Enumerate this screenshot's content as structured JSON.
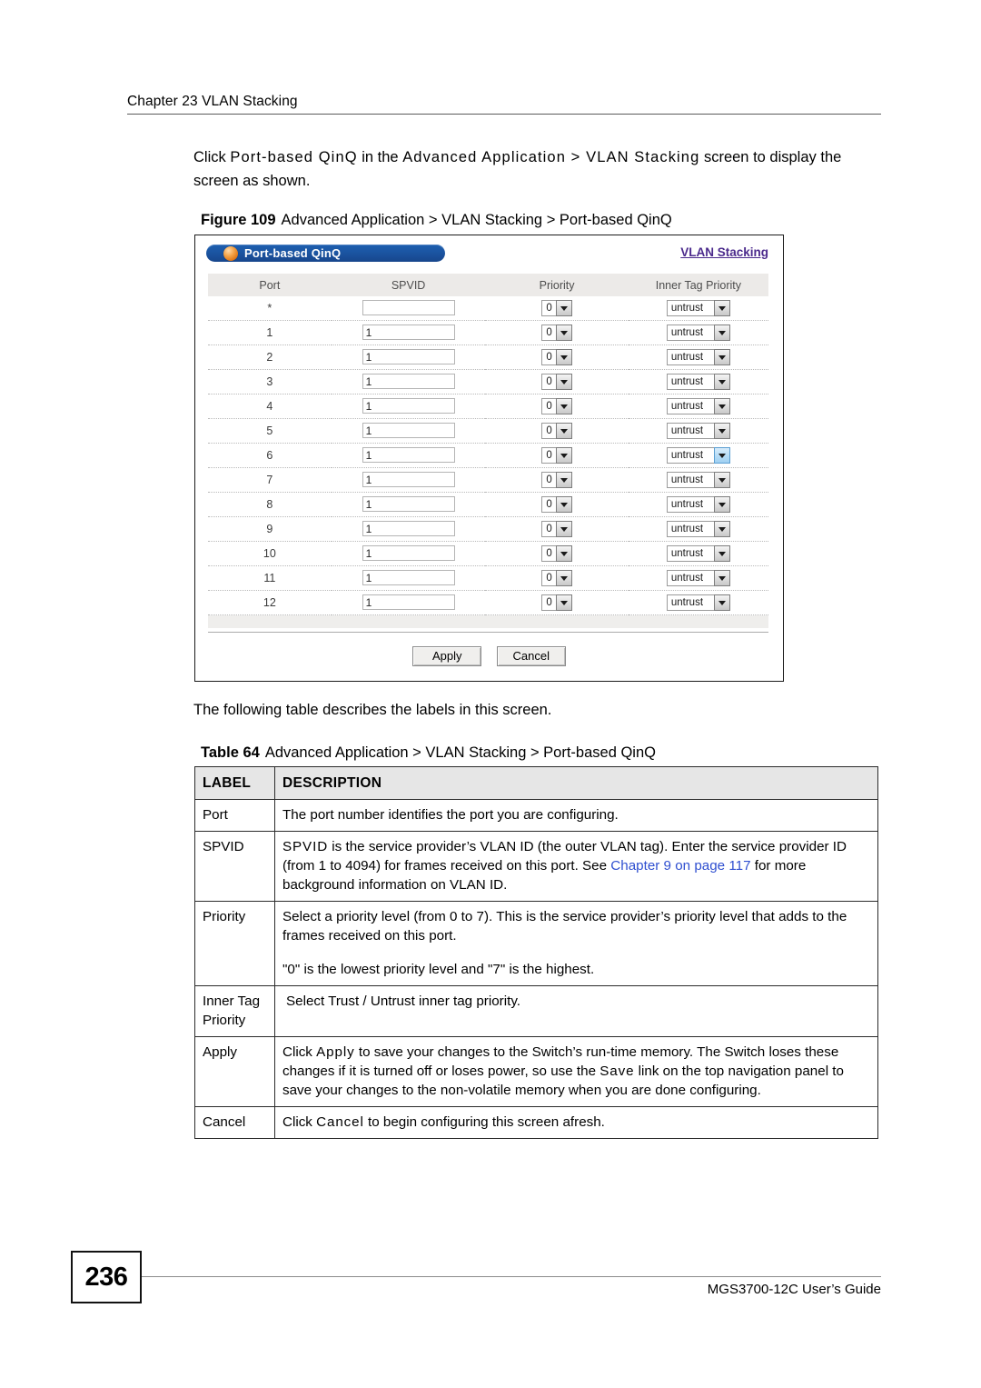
{
  "header": {
    "chapter": "Chapter 23 VLAN Stacking"
  },
  "intro": {
    "line_a": "Click ",
    "term_1": "Port-based QinQ",
    "line_b": " in the ",
    "term_2": "Advanced Application > VLAN Stacking",
    "line_c": " screen to display the screen as shown."
  },
  "figure": {
    "number": "Figure 109",
    "title": "Advanced Application > VLAN Stacking > Port-based QinQ",
    "screen": {
      "titlebar_label": "Port-based QinQ",
      "nav_link": "VLAN Stacking",
      "columns": [
        "Port",
        "SPVID",
        "Priority",
        "Inner Tag Priority"
      ],
      "rows": [
        {
          "port": "*",
          "spvid": "",
          "priority": "0",
          "inner_tag_priority": "untrust",
          "highlight": false
        },
        {
          "port": "1",
          "spvid": "1",
          "priority": "0",
          "inner_tag_priority": "untrust",
          "highlight": false
        },
        {
          "port": "2",
          "spvid": "1",
          "priority": "0",
          "inner_tag_priority": "untrust",
          "highlight": false
        },
        {
          "port": "3",
          "spvid": "1",
          "priority": "0",
          "inner_tag_priority": "untrust",
          "highlight": false
        },
        {
          "port": "4",
          "spvid": "1",
          "priority": "0",
          "inner_tag_priority": "untrust",
          "highlight": false
        },
        {
          "port": "5",
          "spvid": "1",
          "priority": "0",
          "inner_tag_priority": "untrust",
          "highlight": false
        },
        {
          "port": "6",
          "spvid": "1",
          "priority": "0",
          "inner_tag_priority": "untrust",
          "highlight": true
        },
        {
          "port": "7",
          "spvid": "1",
          "priority": "0",
          "inner_tag_priority": "untrust",
          "highlight": false
        },
        {
          "port": "8",
          "spvid": "1",
          "priority": "0",
          "inner_tag_priority": "untrust",
          "highlight": false
        },
        {
          "port": "9",
          "spvid": "1",
          "priority": "0",
          "inner_tag_priority": "untrust",
          "highlight": false
        },
        {
          "port": "10",
          "spvid": "1",
          "priority": "0",
          "inner_tag_priority": "untrust",
          "highlight": false
        },
        {
          "port": "11",
          "spvid": "1",
          "priority": "0",
          "inner_tag_priority": "untrust",
          "highlight": false
        },
        {
          "port": "12",
          "spvid": "1",
          "priority": "0",
          "inner_tag_priority": "untrust",
          "highlight": false
        }
      ],
      "apply_label": "Apply",
      "cancel_label": "Cancel",
      "colors": {
        "titlebar_blue": "#1b55a2",
        "orb_orange": "#e07818",
        "link_purple": "#4b2a8c",
        "header_gray": "#eceae8"
      }
    }
  },
  "between_text": "The following table describes the labels in this screen.",
  "table": {
    "number": "Table 64",
    "title": "Advanced Application > VLAN Stacking > Port-based QinQ",
    "headers": [
      "LABEL",
      "DESCRIPTION"
    ],
    "rows": [
      {
        "label": "Port",
        "desc_1": "The port number identifies the port you are configuring."
      },
      {
        "label": "SPVID",
        "desc_1_a": "SPVID",
        "desc_1_b": " is the service provider’s VLAN ID (the outer VLAN tag). Enter the service provider ID (from 1 to 4094) for frames received on this port. See ",
        "desc_link": "Chapter 9 on page 117",
        "desc_1_c": " for more background information on VLAN ID."
      },
      {
        "label": "Priority",
        "desc_1": "Select a priority level (from 0 to 7). This is the service provider’s priority level that adds to the frames received on this port.",
        "desc_2": "\"0\" is the lowest priority level and \"7\" is the highest."
      },
      {
        "label": "Inner Tag Priority",
        "desc_1": "Select Trust / Untrust inner tag priority."
      },
      {
        "label": "Apply",
        "desc_a": "Click ",
        "desc_term_1": "Apply",
        "desc_b": " to save your changes to the Switch’s run-time memory. The Switch loses these changes if it is turned off or loses power, so use the ",
        "desc_term_2": "Save",
        "desc_c": " link on the top navigation panel to save your changes to the non-volatile memory when you are done configuring."
      },
      {
        "label": "Cancel",
        "desc_a": "Click ",
        "desc_term_1": "Cancel",
        "desc_b": " to begin configuring this screen afresh."
      }
    ]
  },
  "footer": {
    "page_number": "236",
    "guide": "MGS3700-12C User’s Guide"
  }
}
